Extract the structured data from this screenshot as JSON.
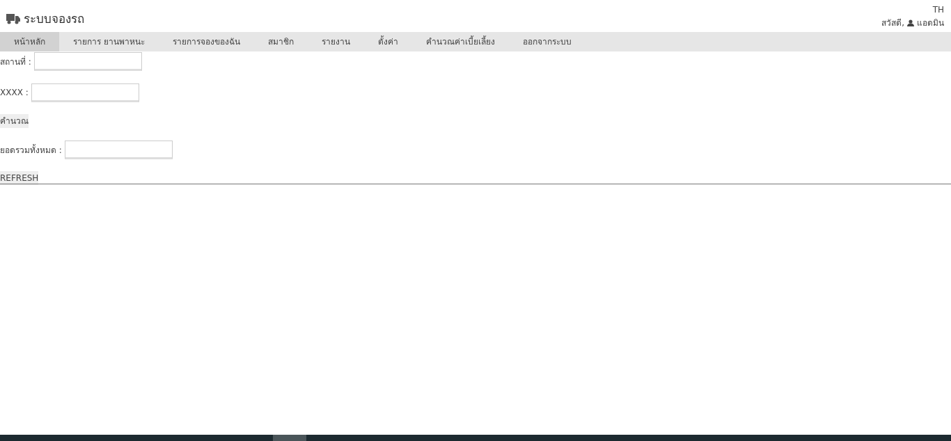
{
  "header": {
    "title": "ระบบจองรถ",
    "language": "TH",
    "greeting": "สวัสดี,",
    "user": "แอดมิน"
  },
  "nav": [
    {
      "label": "หน้าหลัก",
      "selected": true
    },
    {
      "label": "รายการ ยานพาหนะ",
      "selected": false
    },
    {
      "label": "รายการจองของฉัน",
      "selected": false
    },
    {
      "label": "สมาชิก",
      "selected": false
    },
    {
      "label": "รายงาน",
      "selected": false
    },
    {
      "label": "ตั้งค่า",
      "selected": false
    },
    {
      "label": "คำนวณค่าเบี้ยเลี้ยง",
      "selected": false
    },
    {
      "label": "ออกจากระบบ",
      "selected": false
    }
  ],
  "form": [
    {
      "kind": "field",
      "label": "สถานที่ :"
    },
    {
      "kind": "field",
      "label": "XXXX :"
    },
    {
      "kind": "button",
      "label": "คำนวณ"
    },
    {
      "kind": "field",
      "label": "ยอดรวมทั้งหมด :"
    },
    {
      "kind": "button",
      "label": "REFRESH"
    }
  ]
}
